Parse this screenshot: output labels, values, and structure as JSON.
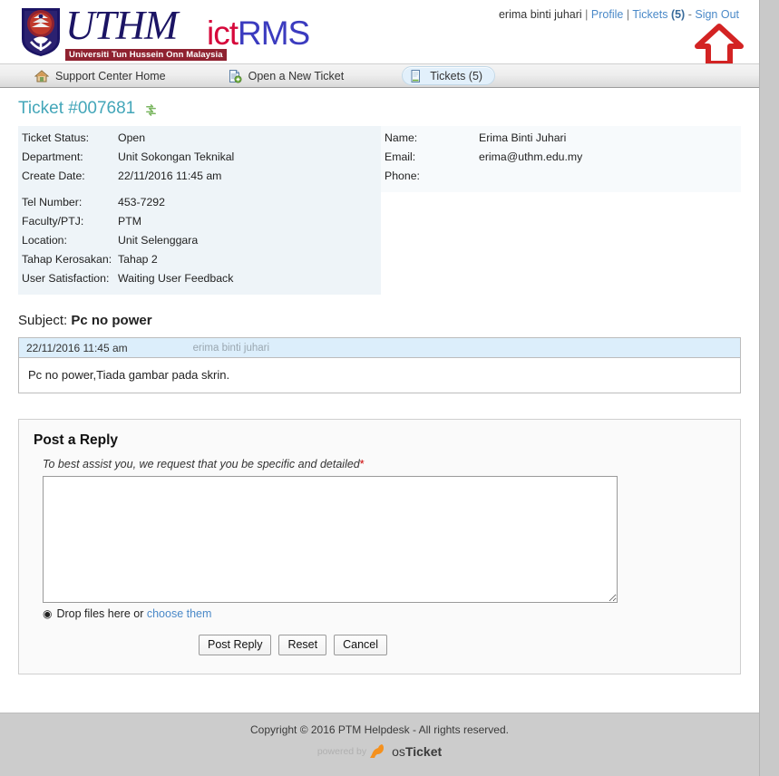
{
  "brand": {
    "university_name": "UTHM",
    "university_tagline": "Universiti Tun Hussein Onn Malaysia",
    "app_prefix": "ict",
    "app_suffix": "RMS",
    "navy": "#1b1464",
    "maroon": "#8f2230",
    "crimson": "#d6083b",
    "blue": "#3b3bbf"
  },
  "userbar": {
    "username": "erima binti juhari",
    "sep1": "|",
    "profile": "Profile",
    "sep2": "|",
    "tickets": "Tickets",
    "tickets_count": "(5)",
    "sep3": "-",
    "signout": "Sign Out"
  },
  "annotation": {
    "arrow_icon": "red-up-arrow",
    "arrow_color": "#d32323",
    "points_to": "Sign Out"
  },
  "nav": {
    "items": [
      {
        "label": "Support Center Home",
        "icon": "home-icon",
        "active": false
      },
      {
        "label": "Open a New Ticket",
        "icon": "new-page-icon",
        "active": false
      },
      {
        "label": "Tickets (5)",
        "icon": "document-icon",
        "active": true
      }
    ]
  },
  "ticket": {
    "title": "Ticket #007681",
    "refresh_icon": "refresh-icon",
    "left_fields": [
      {
        "label": "Ticket Status:",
        "value": "Open"
      },
      {
        "label": "Department:",
        "value": "Unit Sokongan Teknikal"
      },
      {
        "label": "Create Date:",
        "value": "22/11/2016 11:45 am"
      }
    ],
    "left_fields2": [
      {
        "label": "Tel Number:",
        "value": "453-7292"
      },
      {
        "label": "Faculty/PTJ:",
        "value": "PTM"
      },
      {
        "label": "Location:",
        "value": "Unit Selenggara"
      },
      {
        "label": "Tahap Kerosakan:",
        "value": "Tahap 2"
      },
      {
        "label": "User Satisfaction:",
        "value": "Waiting User Feedback"
      }
    ],
    "right_fields": [
      {
        "label": "Name:",
        "value": "Erima Binti Juhari"
      },
      {
        "label": "Email:",
        "value": "erima@uthm.edu.my"
      },
      {
        "label": "Phone:",
        "value": ""
      }
    ],
    "subject_label": "Subject:",
    "subject_value": "Pc no power"
  },
  "thread": {
    "timestamp": "22/11/2016 11:45 am",
    "author": "erima binti juhari",
    "body": "Pc no power,Tiada gambar pada skrin."
  },
  "reply": {
    "heading": "Post a Reply",
    "hint": "To best assist you, we request that you be specific and detailed",
    "required_mark": "*",
    "textarea_value": "",
    "textarea_placeholder": "",
    "drop_icon": "upload-icon",
    "drop_text": "Drop files here or",
    "choose_link": "choose them",
    "buttons": [
      {
        "label": "Post Reply",
        "name": "post-reply-button"
      },
      {
        "label": "Reset",
        "name": "reset-button"
      },
      {
        "label": "Cancel",
        "name": "cancel-button"
      }
    ]
  },
  "footer": {
    "copyright": "Copyright © 2016 PTM Helpdesk - All rights reserved.",
    "powered_by": "powered by",
    "product_os": "os",
    "product_ticket": "Ticket",
    "kangaroo_color": "#f5911e"
  }
}
